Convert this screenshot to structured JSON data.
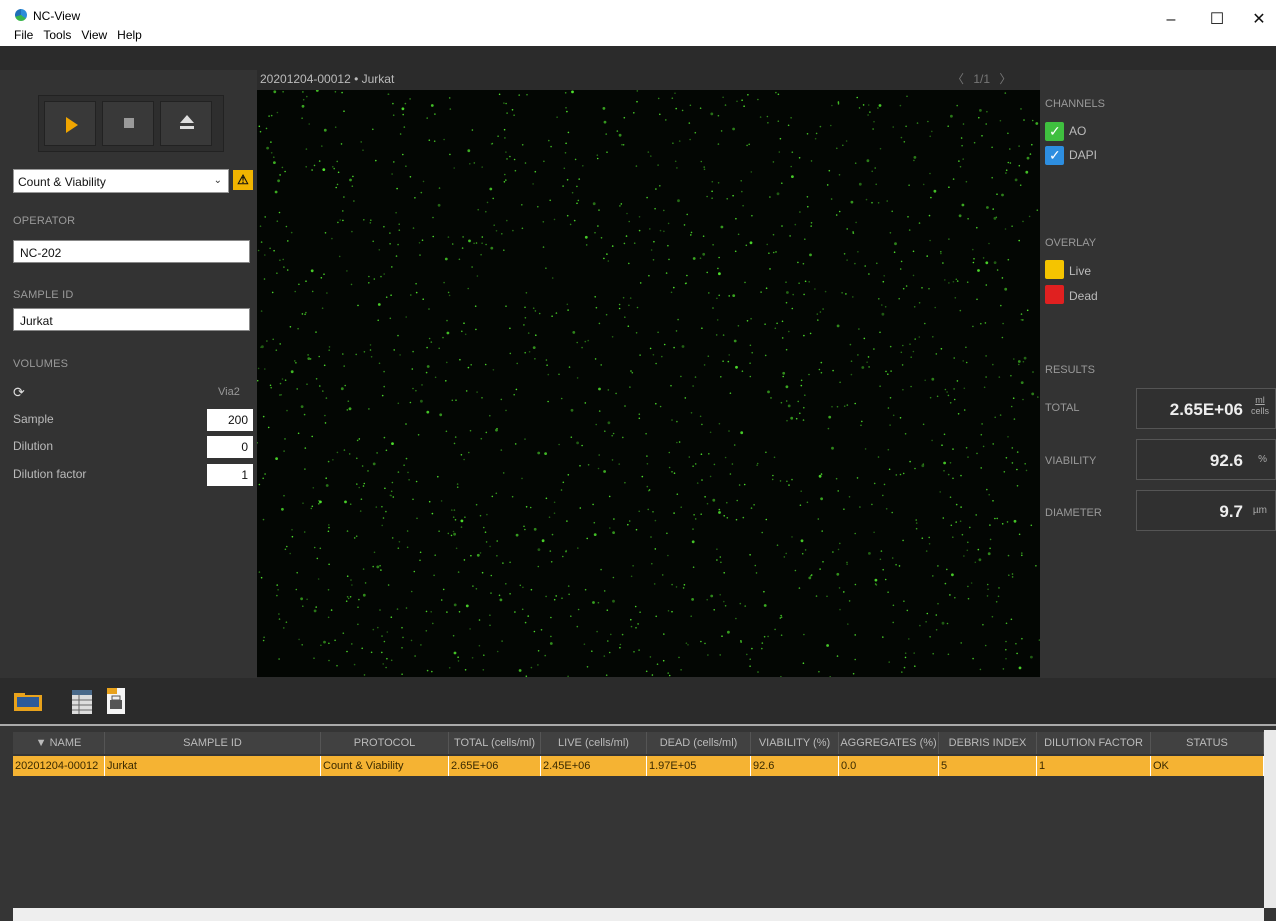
{
  "window": {
    "title": "NC-View",
    "menu": [
      "File",
      "Tools",
      "View",
      "Help"
    ],
    "controls": [
      "–",
      "☐",
      "✕"
    ]
  },
  "left_panel": {
    "protocol": "Count & Viability",
    "operator_label": "OPERATOR",
    "operator_value": "NC-202",
    "sample_id_label": "SAMPLE ID",
    "sample_id_value": "Jurkat",
    "volumes_label": "VOLUMES",
    "via_label": "Via2",
    "volumes": [
      {
        "label": "Sample",
        "value": "200"
      },
      {
        "label": "Dilution",
        "value": "0"
      },
      {
        "label": "Dilution factor",
        "value": "1"
      }
    ]
  },
  "image": {
    "title": "20201204-00012 • Jurkat",
    "page": "1/1"
  },
  "right_panel": {
    "channels_label": "CHANNELS",
    "channels": [
      {
        "name": "AO",
        "color": "#3fbf3f"
      },
      {
        "name": "DAPI",
        "color": "#2d8ee0"
      }
    ],
    "overlay_label": "OVERLAY",
    "overlays": [
      {
        "name": "Live",
        "color": "#f5c400"
      },
      {
        "name": "Dead",
        "color": "#e02020"
      }
    ],
    "results_label": "RESULTS",
    "total_label": "TOTAL",
    "total_value": "2.65E+06",
    "total_unit_top": "ml",
    "total_unit_bottom": "cells",
    "viability_label": "VIABILITY",
    "viability_value": "92.6",
    "viability_unit": "%",
    "diameter_label": "DIAMETER",
    "diameter_value": "9.7",
    "diameter_unit": "µm"
  },
  "table": {
    "columns": [
      "▼ NAME",
      "SAMPLE ID",
      "PROTOCOL",
      "TOTAL (cells/ml)",
      "LIVE (cells/ml)",
      "DEAD (cells/ml)",
      "VIABILITY (%)",
      "AGGREGATES (%)",
      "DEBRIS INDEX",
      "DILUTION FACTOR",
      "STATUS"
    ],
    "rows": [
      [
        "20201204-00012",
        "Jurkat",
        "Count & Viability",
        "2.65E+06",
        "2.45E+06",
        "1.97E+05",
        "92.6",
        "0.0",
        "5",
        "1",
        "OK"
      ]
    ]
  },
  "colors": {
    "accent": "#f0a500",
    "row_highlight": "#f5b333"
  }
}
